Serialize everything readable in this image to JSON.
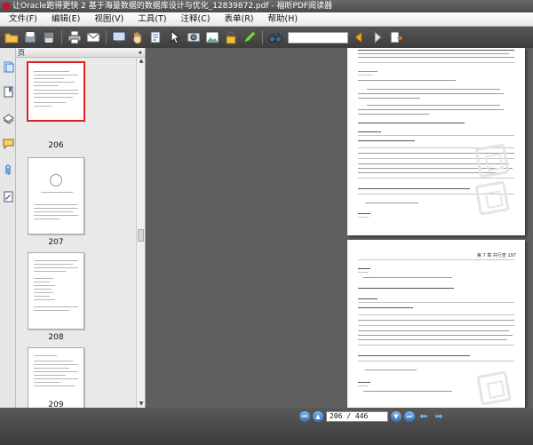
{
  "window": {
    "title": "让Oracle跑得更快 2 基于海量数据的数据库设计与优化_12839872.pdf - 福昕PDF阅读器"
  },
  "menu": [
    {
      "label": "文件(F)"
    },
    {
      "label": "编辑(E)"
    },
    {
      "label": "视图(V)"
    },
    {
      "label": "工具(T)"
    },
    {
      "label": "注释(C)"
    },
    {
      "label": "表单(R)"
    },
    {
      "label": "帮助(H)"
    }
  ],
  "toolbar": {
    "search_value": "",
    "icons": [
      "open-folder-icon",
      "save-icon",
      "save-as-icon",
      "print-icon",
      "email-icon",
      "fullscreen-icon",
      "hand-tool-icon",
      "select-text-icon",
      "select-icon",
      "snapshot-icon",
      "image-icon",
      "lock-icon",
      "pen-icon",
      "binoculars-icon",
      "search-prev-icon",
      "search-next-icon",
      "export-icon"
    ]
  },
  "side_panel": {
    "header": "页",
    "close": "◂",
    "thumbnails": [
      {
        "page": "206",
        "selected": true
      },
      {
        "page": "207",
        "selected": false
      },
      {
        "page": "208",
        "selected": false
      },
      {
        "page": "209",
        "selected": false
      }
    ]
  },
  "document": {
    "page_b_header": "第 7 章  并行查     197"
  },
  "status": {
    "page_indicator": "206 / 446"
  },
  "colors": {
    "selected_thumb_border": "#e02020",
    "nav_button": "#2f6fb8"
  }
}
